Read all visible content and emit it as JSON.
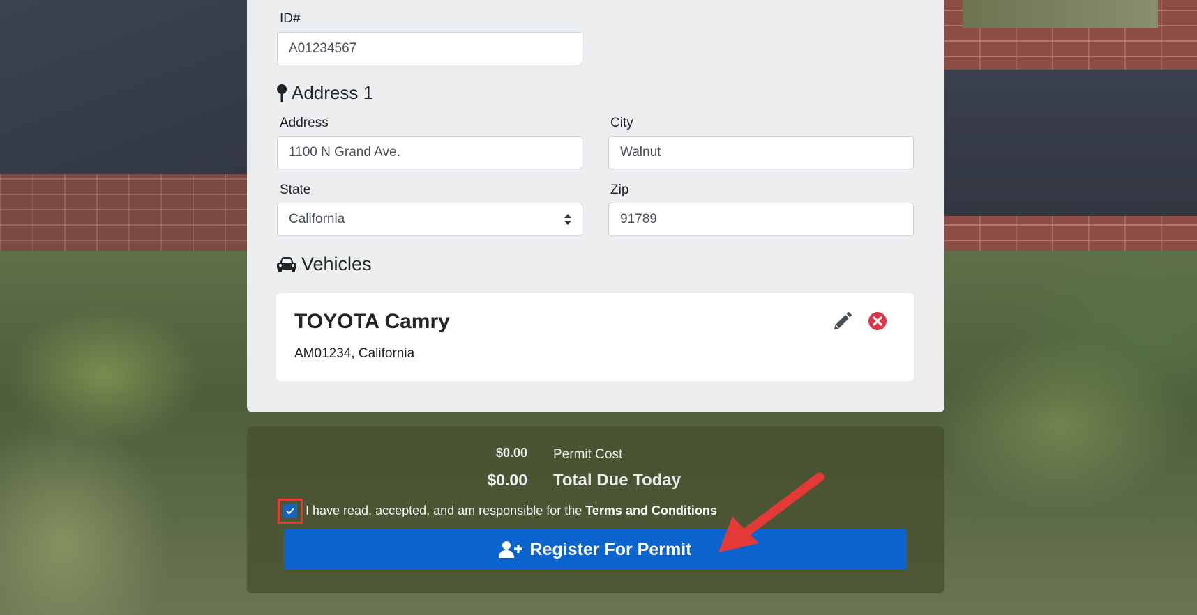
{
  "form": {
    "id_label": "ID#",
    "id_value": "A01234567",
    "address_section_title": "Address 1",
    "address_label": "Address",
    "address_value": "1100 N Grand Ave.",
    "city_label": "City",
    "city_value": "Walnut",
    "state_label": "State",
    "state_value": "California",
    "zip_label": "Zip",
    "zip_value": "91789"
  },
  "vehicles": {
    "section_title": "Vehicles",
    "items": [
      {
        "name": "TOYOTA Camry",
        "plate": "AM01234, California"
      }
    ]
  },
  "payment": {
    "permit_cost_amount": "$0.00",
    "permit_cost_label": "Permit Cost",
    "total_amount": "$0.00",
    "total_label": "Total Due Today",
    "terms_prefix": "I have read, accepted, and am responsible for the ",
    "terms_link": "Terms and Conditions",
    "terms_checked": true,
    "register_label": "Register For Permit"
  },
  "icons": {
    "address": "map-pin-icon",
    "vehicles": "car-icon",
    "edit": "pencil-icon",
    "delete": "remove-circle-icon",
    "register": "user-plus-icon",
    "checkbox": "check-icon"
  },
  "colors": {
    "primary_button": "#0b63ce",
    "delete_icon": "#dc3545",
    "annotation": "#e53935"
  }
}
